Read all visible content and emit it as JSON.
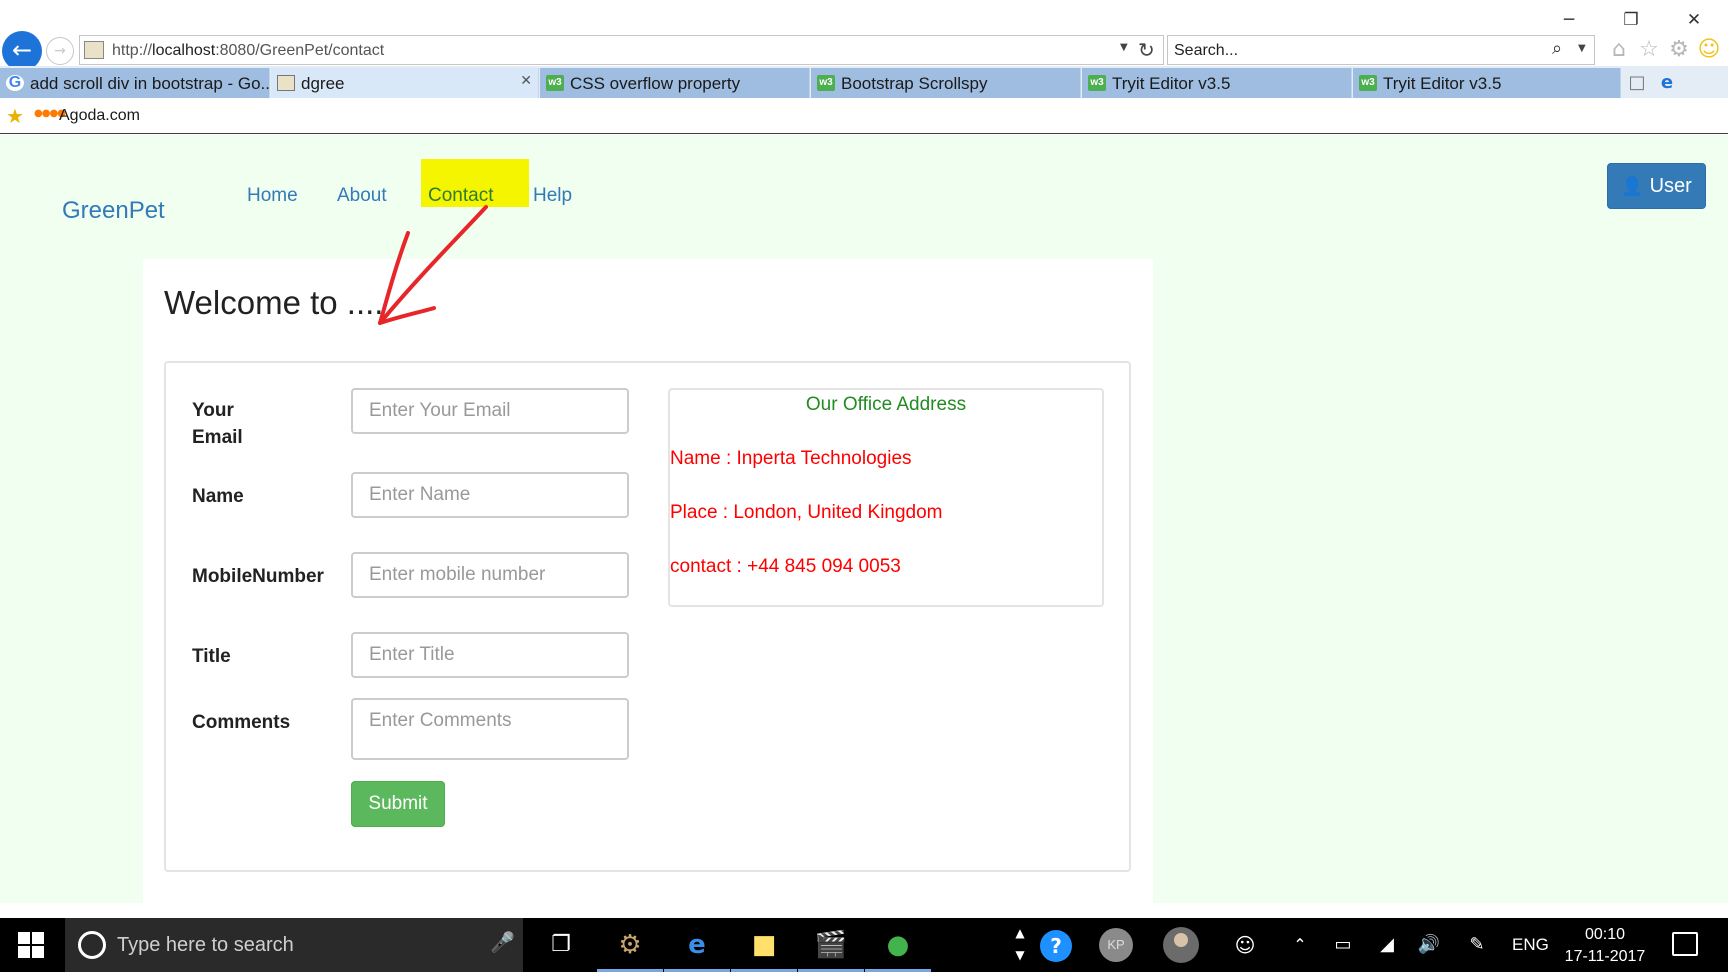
{
  "browser": {
    "url_prefix": "http://",
    "url_host": "localhost",
    "url_rest": ":8080/GreenPet/contact",
    "search_placeholder": "Search...",
    "tabs": [
      {
        "label": "add scroll div in bootstrap - Go...",
        "icon": "google-icon"
      },
      {
        "label": "dgree",
        "icon": "page-icon",
        "active": true
      },
      {
        "label": "CSS overflow property",
        "icon": "w3schools-icon"
      },
      {
        "label": "Bootstrap Scrollspy",
        "icon": "w3schools-icon"
      },
      {
        "label": "Tryit Editor v3.5",
        "icon": "w3schools-icon"
      },
      {
        "label": "Tryit Editor v3.5",
        "icon": "w3schools-icon"
      }
    ],
    "favorites": [
      {
        "label": "Agoda.com"
      }
    ]
  },
  "site": {
    "brand": "GreenPet",
    "nav": [
      {
        "label": "Home"
      },
      {
        "label": "About"
      },
      {
        "label": "Contact",
        "highlighted": true
      },
      {
        "label": "Help"
      }
    ],
    "user_button": "User",
    "highlight_color": "#f5f500",
    "brand_color": "#337ab7",
    "page_bg": "#f0fff0"
  },
  "main": {
    "welcome": "Welcome to ....",
    "form": {
      "email_label_line1": "Your",
      "email_label_line2": "Email",
      "email_placeholder": "Enter Your Email",
      "name_label": "Name",
      "name_placeholder": "Enter Name",
      "mobile_label": "MobileNumber",
      "mobile_placeholder": "Enter mobile number",
      "title_label": "Title",
      "title_placeholder": "Enter Title",
      "comments_label": "Comments",
      "comments_placeholder": "Enter Comments",
      "submit": "Submit"
    },
    "office": {
      "title": "Our Office Address",
      "name_line": "Name : Inperta Technologies",
      "place_line": "Place : London, United Kingdom",
      "contact_line": "contact : +44 845 094 0053",
      "title_color": "#228b22",
      "text_color": "#ff0000"
    }
  },
  "taskbar": {
    "search_placeholder": "Type here to search",
    "help_glyph": "?",
    "avatar_initials": "KP",
    "language": "ENG",
    "time": "00:10",
    "date": "17-11-2017"
  }
}
